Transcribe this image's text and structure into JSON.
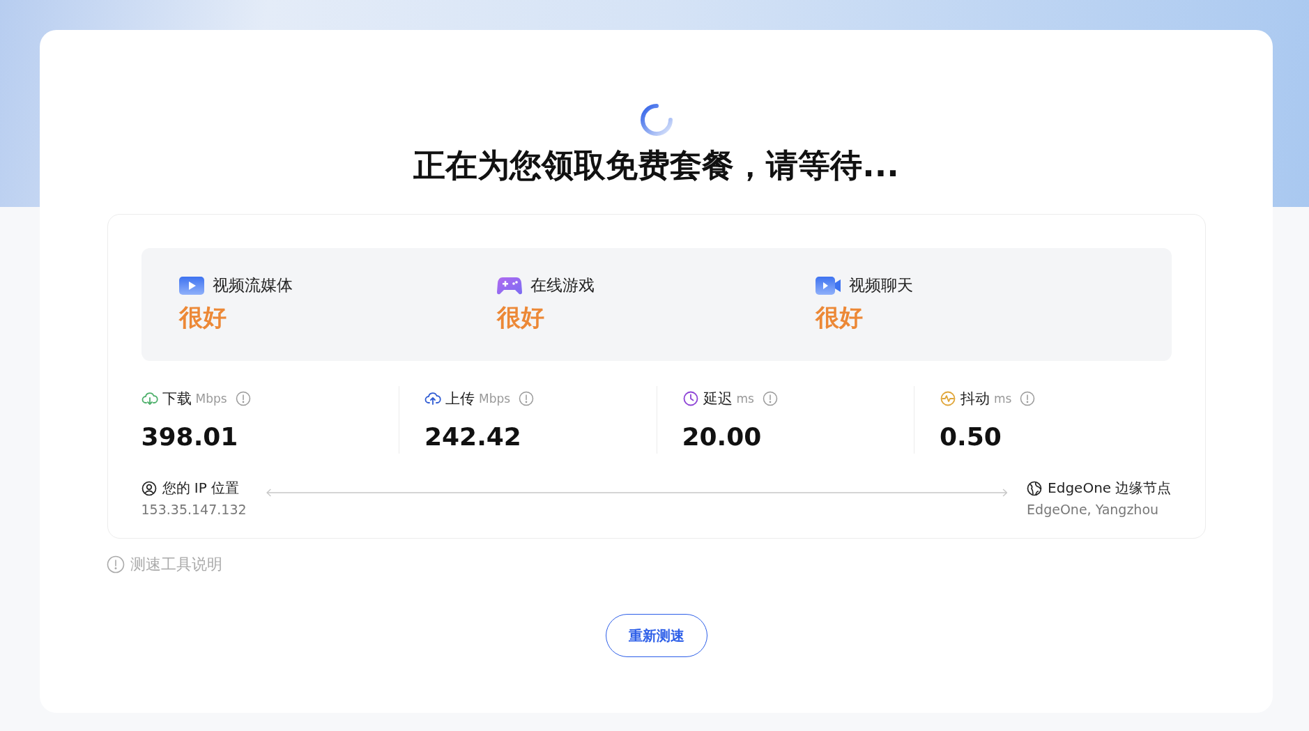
{
  "title": "正在为您领取免费套餐，请等待...",
  "quality": [
    {
      "kind": "streaming",
      "label": "视频流媒体",
      "rating": "很好"
    },
    {
      "kind": "gaming",
      "label": "在线游戏",
      "rating": "很好"
    },
    {
      "kind": "videochat",
      "label": "视频聊天",
      "rating": "很好"
    }
  ],
  "metrics": [
    {
      "kind": "download",
      "label": "下载",
      "unit": "Mbps",
      "value": "398.01"
    },
    {
      "kind": "upload",
      "label": "上传",
      "unit": "Mbps",
      "value": "242.42"
    },
    {
      "kind": "latency",
      "label": "延迟",
      "unit": "ms",
      "value": "20.00"
    },
    {
      "kind": "jitter",
      "label": "抖动",
      "unit": "ms",
      "value": "0.50"
    }
  ],
  "client": {
    "label": "您的 IP 位置",
    "value": "153.35.147.132"
  },
  "server": {
    "label": "EdgeOne 边缘节点",
    "value": "EdgeOne, Yangzhou"
  },
  "info_link": "测速工具说明",
  "retest_button": "重新测速"
}
